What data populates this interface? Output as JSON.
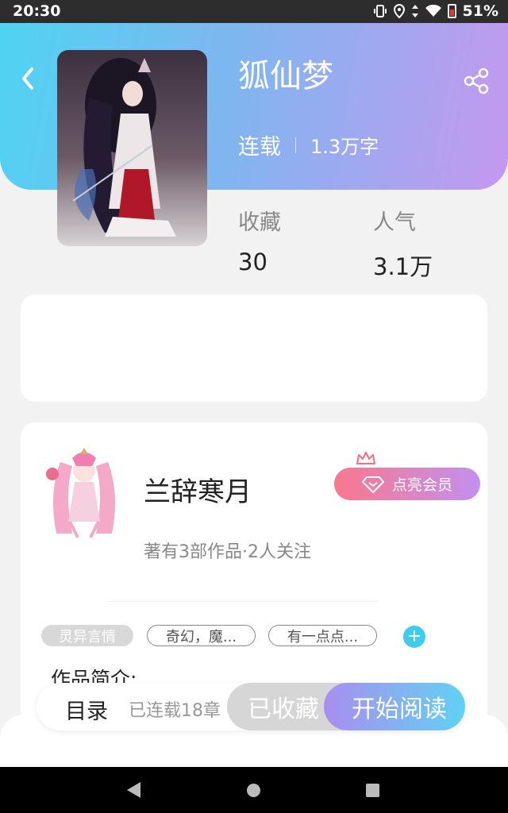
{
  "status_bar": {
    "time": "20:30",
    "battery": "51%"
  },
  "book": {
    "title": "狐仙梦",
    "status": "连载",
    "word_count": "1.3万字",
    "stats": {
      "favorites_label": "收藏",
      "favorites_value": "30",
      "popularity_label": "人气",
      "popularity_value": "3.1万"
    }
  },
  "author": {
    "name": "兰辞寒月",
    "meta": "著有3部作品·2人关注",
    "vip_button": "点亮会员"
  },
  "tags": [
    "灵异言情",
    "奇幻，魔...",
    "有一点点..."
  ],
  "add_tag": "+",
  "intro_heading": "作品简介:",
  "bottom_bar": {
    "toc": "目录",
    "chapters": "已连载18章",
    "favorited": "已收藏",
    "start_reading": "开始阅读"
  },
  "colors": {
    "accent_cyan": "#4fd3f3",
    "accent_purple": "#c598ef",
    "vip_pink": "#f9788d"
  },
  "icons": [
    "back-arrow-icon",
    "share-icon",
    "crown-icon",
    "diamond-icon"
  ]
}
